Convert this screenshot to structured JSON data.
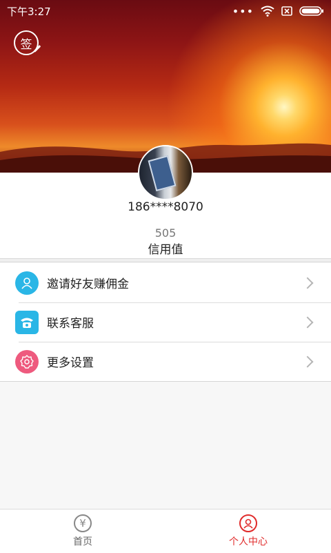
{
  "status_bar": {
    "time": "下午3:27"
  },
  "header": {
    "sign_label": "签"
  },
  "profile": {
    "phone": "186****8070",
    "credit_score": "505",
    "credit_label": "信用值"
  },
  "menu": [
    {
      "label": "邀请好友赚佣金",
      "icon": "invite-user-icon",
      "color": "#2ab6e6"
    },
    {
      "label": "联系客服",
      "icon": "phone-icon",
      "color": "#2ab6e6"
    },
    {
      "label": "更多设置",
      "icon": "settings-gear-icon",
      "color": "#ee5a7e"
    }
  ],
  "tabbar": [
    {
      "label": "首页",
      "icon": "yen-icon",
      "active": false,
      "symbol": "¥"
    },
    {
      "label": "个人中心",
      "icon": "user-center-icon",
      "active": true
    }
  ],
  "colors": {
    "active": "#e02a2a",
    "inactive": "#666666"
  }
}
